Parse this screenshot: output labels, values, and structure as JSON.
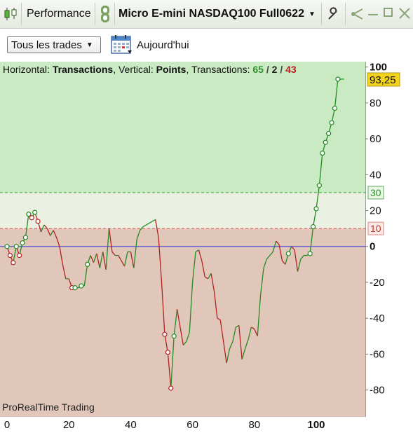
{
  "window": {
    "tab_label": "Performance",
    "instrument_label": "Micro E-mini NASDAQ100 Full0622"
  },
  "toolbar": {
    "filter_value": "Tous les trades",
    "date_label": "Aujourd'hui"
  },
  "info_bar": {
    "horizontal_label": "Horizontal: ",
    "horizontal_value": "Transactions",
    "vertical_label": ", Vertical: ",
    "vertical_value": "Points",
    "transactions_label": ", Transactions: ",
    "winners": "65",
    "separator": "/",
    "neutral": "2",
    "losers": "43"
  },
  "watermark": "ProRealTime Trading",
  "colors": {
    "profit_zone": "#c9eac3",
    "mid_zone": "#eaf1e3",
    "loss_zone": "#e0c7b9",
    "line_up": "#228b22",
    "line_down": "#b22222",
    "zero_line": "#3b3bd6",
    "price_tag": "#f2d21c"
  },
  "chart_data": {
    "type": "line",
    "xlabel": "",
    "ylabel": "",
    "xlim": [
      0,
      110
    ],
    "ylim": [
      -95,
      103
    ],
    "x_ticks": [
      "0",
      "20",
      "40",
      "60",
      "80",
      "100"
    ],
    "y_ticks": [
      "100",
      "80",
      "60",
      "40",
      "20",
      "0",
      "-20",
      "-40",
      "-60",
      "-80"
    ],
    "reference_lines": [
      {
        "label": "30",
        "value": 30
      },
      {
        "label": "10",
        "value": 10
      }
    ],
    "last_value_label": "93,25",
    "last_value": 93.25,
    "x": [
      0,
      1,
      2,
      3,
      4,
      5,
      6,
      7,
      8,
      9,
      10,
      11,
      12,
      13,
      14,
      15,
      16,
      17,
      18,
      19,
      20,
      21,
      22,
      23,
      24,
      25,
      26,
      27,
      28,
      29,
      30,
      31,
      32,
      33,
      34,
      35,
      36,
      37,
      38,
      39,
      40,
      41,
      42,
      43,
      44,
      45,
      46,
      47,
      48,
      49,
      50,
      51,
      52,
      53,
      54,
      55,
      56,
      57,
      58,
      59,
      60,
      61,
      62,
      63,
      64,
      65,
      66,
      67,
      68,
      69,
      70,
      71,
      72,
      73,
      74,
      75,
      76,
      77,
      78,
      79,
      80,
      81,
      82,
      83,
      84,
      85,
      86,
      87,
      88,
      89,
      90,
      91,
      92,
      93,
      94,
      95,
      96,
      97,
      98,
      99,
      100,
      101,
      102,
      103,
      104,
      105,
      106,
      107,
      108,
      109
    ],
    "y": [
      0,
      -5,
      -9,
      0,
      -5,
      2,
      5,
      18,
      16,
      19,
      14,
      8,
      12,
      10,
      6,
      9,
      5,
      0,
      -10,
      -18,
      -18,
      -23,
      -23,
      -23,
      -22,
      -22,
      -10,
      -5,
      -9,
      -4,
      -12,
      -3,
      -13,
      10,
      -3,
      -5,
      -5,
      -8,
      -11,
      -3,
      -3,
      -12,
      4,
      9,
      11,
      12,
      13,
      14,
      15,
      5,
      -20,
      -49,
      -59,
      -79,
      -50,
      -35,
      -45,
      -55,
      -53,
      -48,
      -20,
      -3,
      -2,
      -8,
      -17,
      -18,
      -15,
      -25,
      -40,
      -41,
      -53,
      -65,
      -57,
      -53,
      -45,
      -44,
      -63,
      -57,
      -52,
      -45,
      -46,
      -50,
      -27,
      -12,
      -7,
      -5,
      -3,
      3,
      1,
      -8,
      -10,
      -4,
      0,
      -2,
      -14,
      -7,
      -5,
      -5,
      -4,
      11,
      21,
      34,
      52,
      58,
      63,
      69,
      77,
      93.25,
      93.25,
      93.25
    ],
    "markers_x": [
      0,
      1,
      2,
      3,
      4,
      5,
      6,
      7,
      8,
      9,
      10,
      21,
      22,
      24,
      26,
      51,
      52,
      53,
      54,
      91,
      98,
      99,
      100,
      101,
      102,
      103,
      104,
      105,
      106,
      107
    ]
  }
}
